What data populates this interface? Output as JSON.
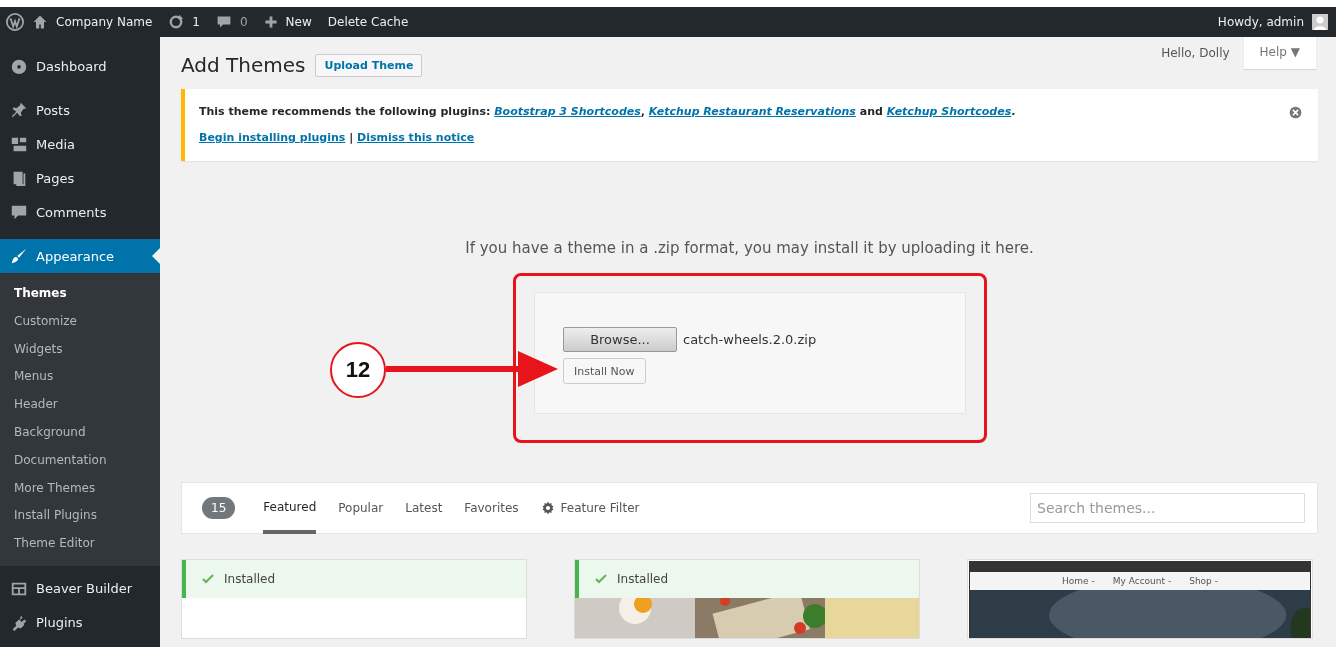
{
  "admin_bar": {
    "site_name": "Company Name",
    "updates": "1",
    "comments": "0",
    "new": "New",
    "delete_cache": "Delete Cache",
    "greeting": "Howdy, admin"
  },
  "sidebar": {
    "items": [
      {
        "label": "Dashboard",
        "selected": false
      },
      {
        "label": "Posts",
        "selected": false
      },
      {
        "label": "Media",
        "selected": false
      },
      {
        "label": "Pages",
        "selected": false
      },
      {
        "label": "Comments",
        "selected": false
      },
      {
        "label": "Appearance",
        "selected": true,
        "children": [
          {
            "label": "Themes",
            "selected": true
          },
          {
            "label": "Customize",
            "selected": false
          },
          {
            "label": "Widgets",
            "selected": false
          },
          {
            "label": "Menus",
            "selected": false
          },
          {
            "label": "Header",
            "selected": false
          },
          {
            "label": "Background",
            "selected": false
          },
          {
            "label": "Documentation",
            "selected": false
          },
          {
            "label": "More Themes",
            "selected": false
          },
          {
            "label": "Install Plugins",
            "selected": false
          },
          {
            "label": "Theme Editor",
            "selected": false
          }
        ]
      },
      {
        "label": "Beaver Builder",
        "selected": false
      },
      {
        "label": "Plugins",
        "selected": false
      }
    ]
  },
  "screen_meta": {
    "hello": "Hello, Dolly",
    "help": "Help ▼"
  },
  "page": {
    "title": "Add Themes",
    "upload_button": "Upload Theme"
  },
  "notice": {
    "text": "This theme recommends the following plugins: ",
    "links": [
      "Bootstrap 3 Shortcodes",
      "Ketchup Restaurant Reservations",
      "Ketchup Shortcodes"
    ],
    "separators": [
      ", ",
      " and ",
      "."
    ],
    "actions": [
      "Begin installing plugins",
      "Dismiss this notice"
    ],
    "action_separator": " | "
  },
  "upload": {
    "message": "If you have a theme in a .zip format, you may install it by uploading it here.",
    "browse": "Browse...",
    "file_name": "catch-wheels.2.0.zip",
    "install": "Install Now"
  },
  "annotation": {
    "step": "12"
  },
  "filter": {
    "count": "15",
    "tabs": [
      {
        "label": "Featured",
        "selected": true
      },
      {
        "label": "Popular",
        "selected": false
      },
      {
        "label": "Latest",
        "selected": false
      },
      {
        "label": "Favorites",
        "selected": false
      }
    ],
    "feature_filter": "Feature Filter",
    "search_placeholder": "Search themes..."
  },
  "themes": [
    {
      "installed": true,
      "badge": "Installed",
      "kind": "blank"
    },
    {
      "installed": true,
      "badge": "Installed",
      "kind": "picture"
    },
    {
      "installed": false,
      "kind": "site",
      "nav": [
        "Home -",
        "My Account -",
        "Shop -"
      ]
    }
  ]
}
